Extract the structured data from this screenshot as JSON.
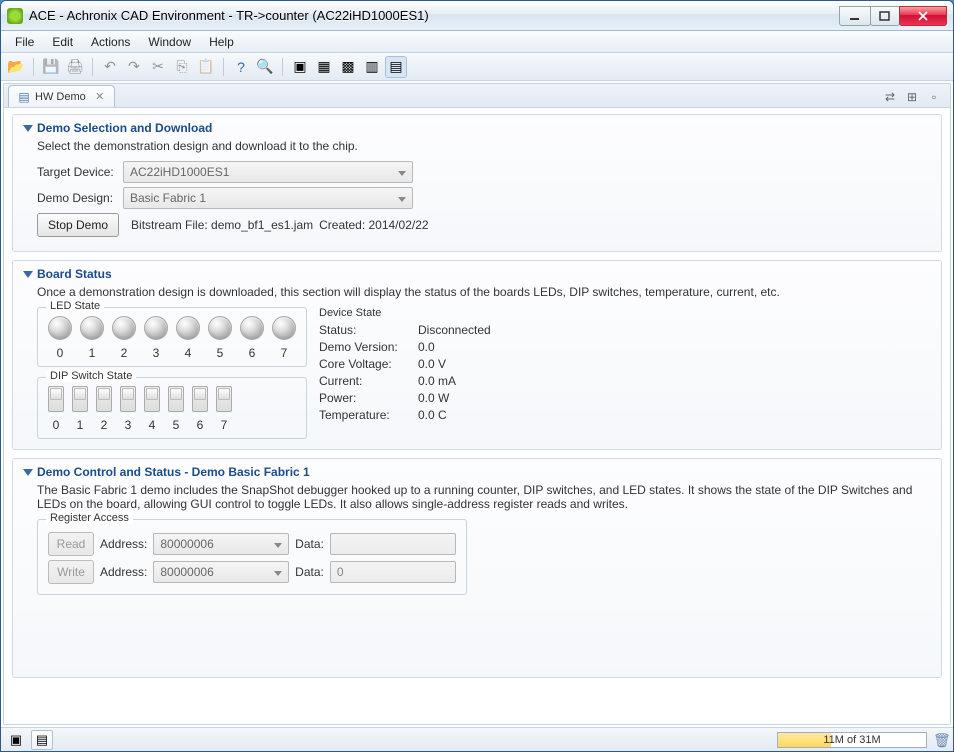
{
  "window": {
    "title": "ACE - Achronix CAD Environment - TR->counter (AC22iHD1000ES1)"
  },
  "menu": {
    "file": "File",
    "edit": "Edit",
    "actions": "Actions",
    "window": "Window",
    "help": "Help"
  },
  "tab": {
    "label": "HW Demo"
  },
  "demo_selection": {
    "title": "Demo Selection and Download",
    "desc": "Select the demonstration design and download it to the chip.",
    "target_label": "Target Device:",
    "target_value": "AC22iHD1000ES1",
    "design_label": "Demo Design:",
    "design_value": "Basic Fabric 1",
    "stop_btn": "Stop Demo",
    "bitstream_label": "Bitstream File: demo_bf1_es1.jam",
    "created_label": "Created: 2014/02/22"
  },
  "board_status": {
    "title": "Board Status",
    "desc": "Once a demonstration design is downloaded, this section will display the status of the boards LEDs, DIP switches, temperature, current, etc.",
    "led_group": "LED State",
    "dip_group": "DIP Switch State",
    "device_group": "Device State",
    "led_indices": [
      "0",
      "1",
      "2",
      "3",
      "4",
      "5",
      "6",
      "7"
    ],
    "dip_indices": [
      "0",
      "1",
      "2",
      "3",
      "4",
      "5",
      "6",
      "7"
    ],
    "status_k": "Status:",
    "status_v": "Disconnected",
    "demov_k": "Demo Version:",
    "demov_v": "0.0",
    "corev_k": "Core Voltage:",
    "corev_v": "0.0 V",
    "curr_k": "Current:",
    "curr_v": "0.0 mA",
    "power_k": "Power:",
    "power_v": "0.0 W",
    "temp_k": "Temperature:",
    "temp_v": "0.0 C"
  },
  "demo_control": {
    "title": "Demo Control and Status - Demo Basic Fabric 1",
    "desc": "The Basic Fabric 1 demo includes the SnapShot debugger hooked up to a running counter, DIP switches, and LED states.  It shows the state of the DIP Switches and LEDs on the board, allowing GUI control to toggle LEDs.  It also allows single-address register reads and writes.",
    "reg_group": "Register Access",
    "read_btn": "Read",
    "write_btn": "Write",
    "addr_label": "Address:",
    "data_label": "Data:",
    "read_addr": "80000006",
    "read_data": "",
    "write_addr": "80000006",
    "write_data": "0"
  },
  "statusbar": {
    "mem": "11M of 31M"
  }
}
